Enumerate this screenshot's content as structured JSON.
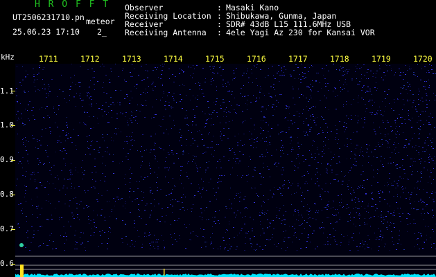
{
  "header": {
    "title": "H R O F F T",
    "filename": "UT2506231710.pn",
    "mode": "meteor",
    "datetime": "25.06.23 17:10",
    "counter": "2_",
    "fields": [
      {
        "label": "Observer",
        "sep": ":",
        "value": "Masaki Kano"
      },
      {
        "label": "Receiving Location",
        "sep": ":",
        "value": "Shibukawa, Gunma, Japan"
      },
      {
        "label": "Receiver",
        "sep": ":",
        "value": "SDR# 43dB L15 111.6MHz USB"
      },
      {
        "label": "Receiving Antenna",
        "sep": ":",
        "value": "4ele Yagi Az 230 for Kansai VOR"
      }
    ]
  },
  "time_axis": {
    "labels": [
      "1711",
      "1712",
      "1713",
      "1714",
      "1715",
      "1716",
      "1717",
      "1718",
      "1719",
      "1720"
    ]
  },
  "freq_axis": {
    "unit": "kHz",
    "labels": [
      "1.1",
      "1.0",
      "0.9",
      "0.8",
      "0.7",
      "0.6"
    ]
  },
  "colors": {
    "background": "#000000",
    "spectrum_noise": "#1a1a8c",
    "signal_level": "#00e6ff",
    "axis_text": "#ffff40",
    "title_green": "#21c321"
  }
}
